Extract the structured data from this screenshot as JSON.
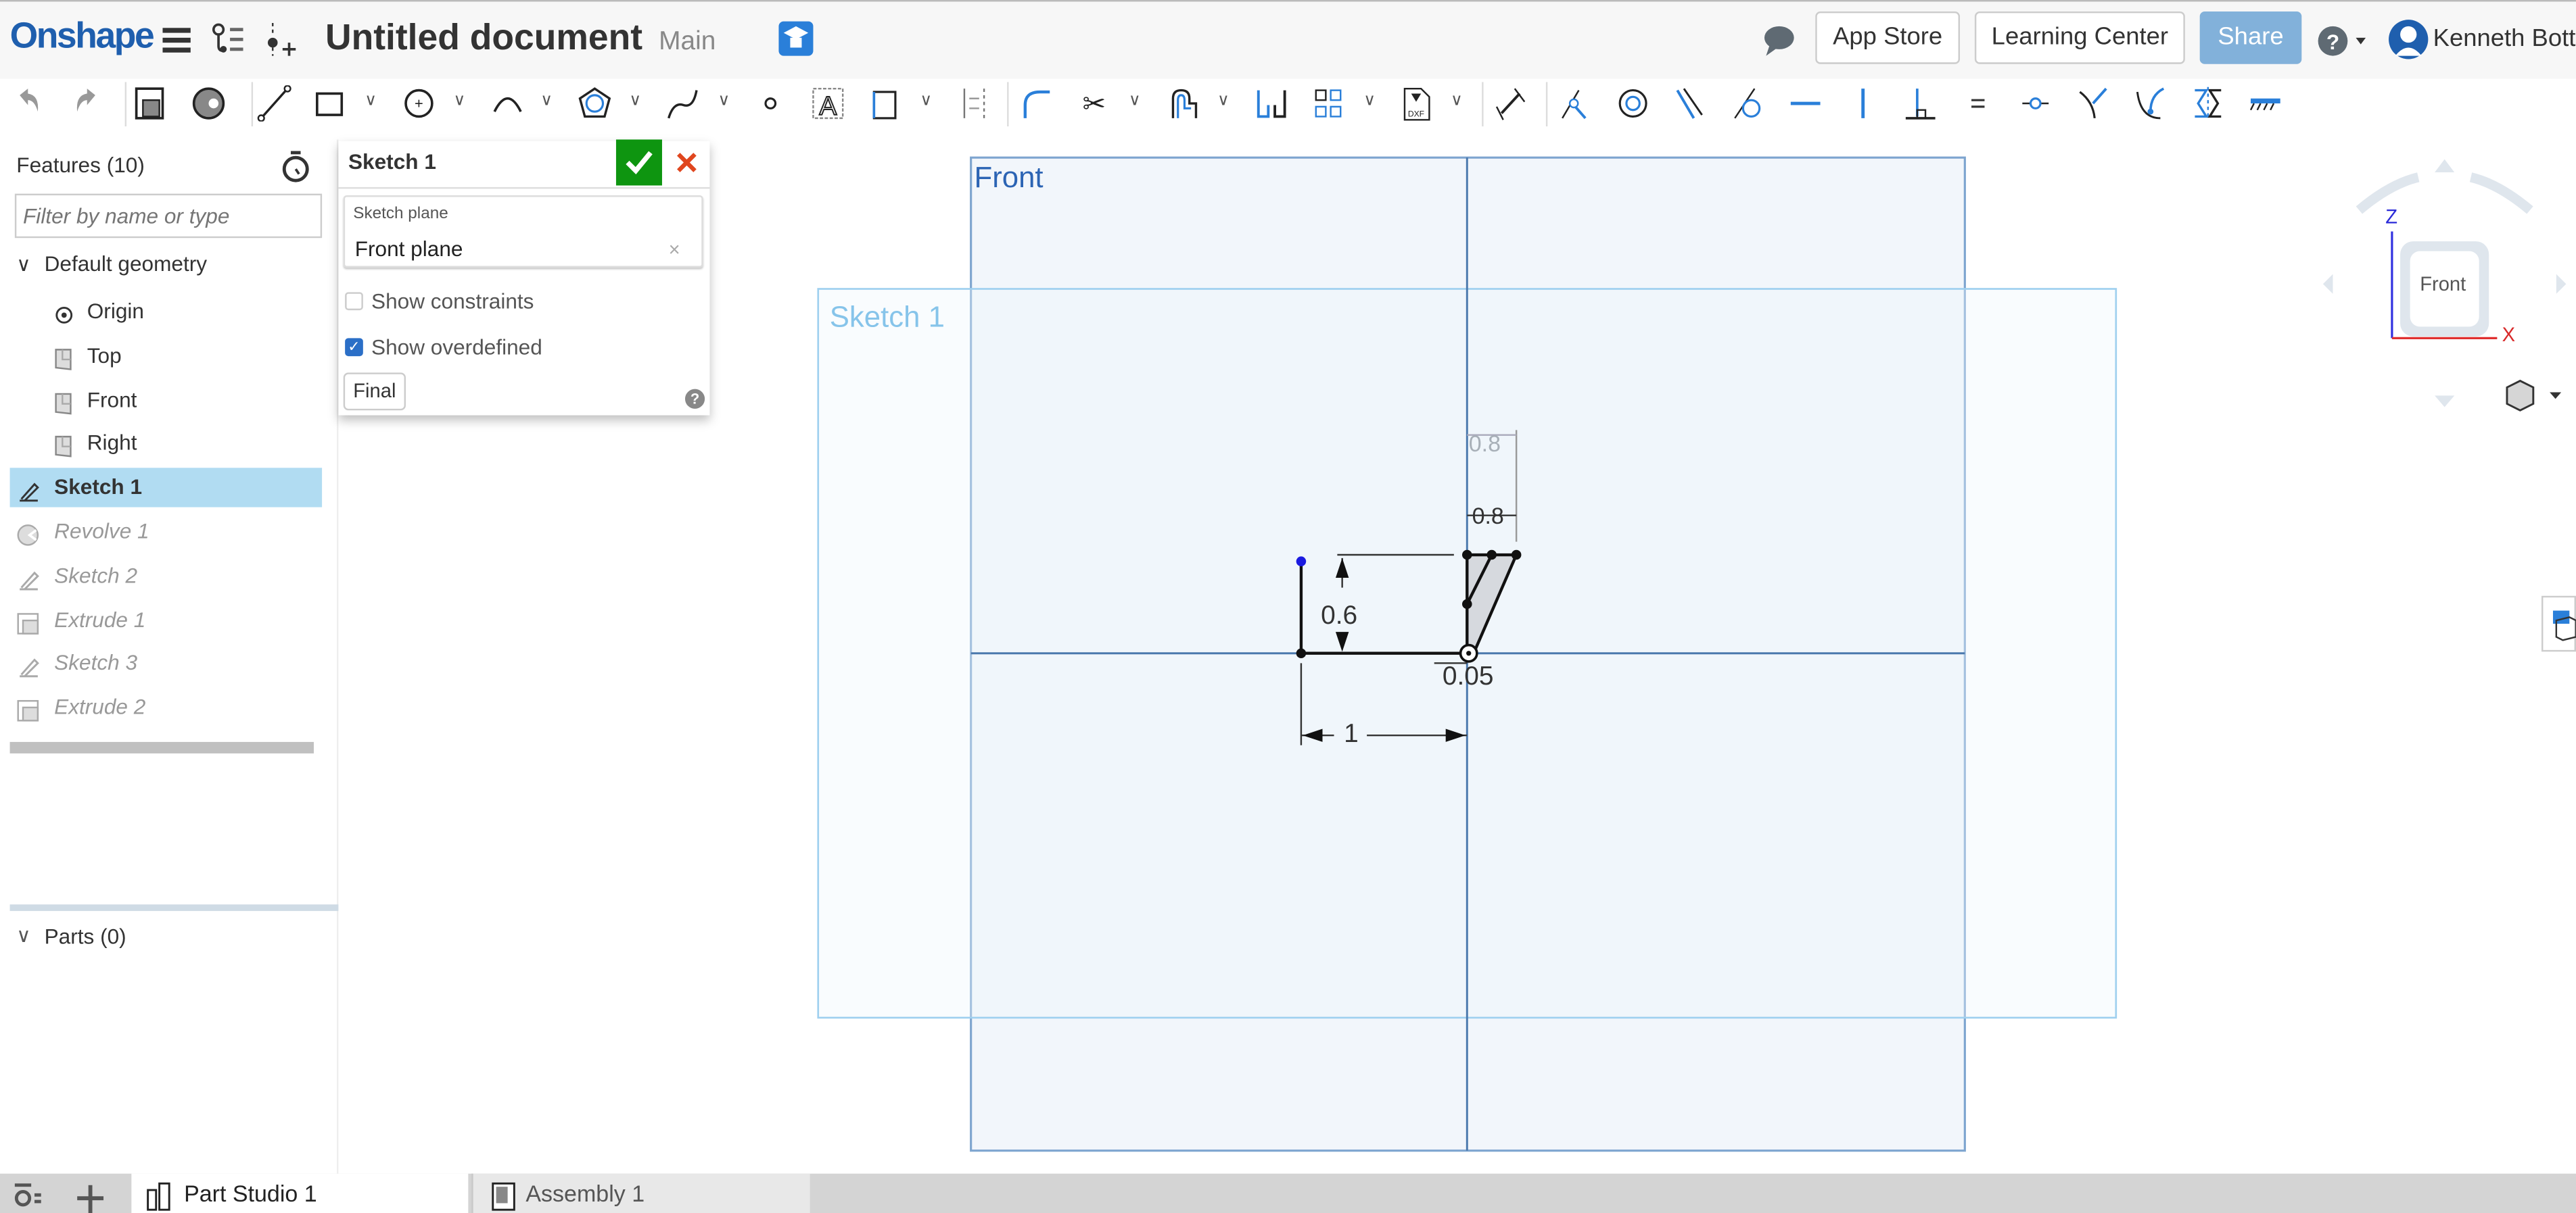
{
  "header": {
    "logo": "Onshape",
    "document_title": "Untitled document",
    "branch": "Main",
    "buttons": {
      "app_store": "App Store",
      "learning_center": "Learning Center",
      "share": "Share"
    },
    "user_name": "Kenneth Bott",
    "colors": {
      "brand": "#1f5fae",
      "share_bg": "#82b1da",
      "learn_badge": "#2a7fd9"
    }
  },
  "toolbar": {
    "tools": [
      {
        "icon": "undo-icon"
      },
      {
        "icon": "redo-icon"
      },
      {
        "icon": "extrude-icon"
      },
      {
        "icon": "revolve-icon"
      },
      {
        "icon": "line-icon"
      },
      {
        "icon": "rectangle-icon",
        "dropdown": true
      },
      {
        "icon": "circle-icon",
        "dropdown": true
      },
      {
        "icon": "arc-icon",
        "dropdown": true
      },
      {
        "icon": "polygon-icon",
        "dropdown": true
      },
      {
        "icon": "spline-icon",
        "dropdown": true
      },
      {
        "icon": "point-icon"
      },
      {
        "icon": "text-icon"
      },
      {
        "icon": "construction-icon",
        "dropdown": true
      },
      {
        "icon": "mirror-icon"
      },
      {
        "icon": "fillet-icon"
      },
      {
        "icon": "trim-icon",
        "dropdown": true
      },
      {
        "icon": "offset-icon",
        "dropdown": true
      },
      {
        "icon": "sketch-mirror-icon"
      },
      {
        "icon": "pattern-icon",
        "dropdown": true
      },
      {
        "icon": "dxf-import-icon",
        "dropdown": true
      },
      {
        "icon": "dimension-icon"
      },
      {
        "icon": "coincident-icon"
      },
      {
        "icon": "concentric-icon"
      },
      {
        "icon": "parallel-icon"
      },
      {
        "icon": "tangent-icon"
      },
      {
        "icon": "horizontal-icon"
      },
      {
        "icon": "vertical-icon"
      },
      {
        "icon": "perpendicular-icon"
      },
      {
        "icon": "equal-icon"
      },
      {
        "icon": "midpoint-icon"
      },
      {
        "icon": "normal-icon"
      },
      {
        "icon": "pierce-icon"
      },
      {
        "icon": "symmetric-icon"
      },
      {
        "icon": "fix-icon"
      }
    ]
  },
  "feature_panel": {
    "title": "Features (10)",
    "filter_placeholder": "Filter by name or type",
    "default_geometry_label": "Default geometry",
    "items": [
      {
        "label": "Origin",
        "icon": "origin-icon",
        "state": "normal",
        "indent": true
      },
      {
        "label": "Top",
        "icon": "plane-icon",
        "state": "normal",
        "indent": true
      },
      {
        "label": "Front",
        "icon": "plane-icon",
        "state": "normal",
        "indent": true
      },
      {
        "label": "Right",
        "icon": "plane-icon",
        "state": "normal",
        "indent": true
      },
      {
        "label": "Sketch 1",
        "icon": "sketch-icon",
        "state": "selected"
      },
      {
        "label": "Revolve 1",
        "icon": "revolve-icon",
        "state": "rolled-back"
      },
      {
        "label": "Sketch 2",
        "icon": "sketch-icon",
        "state": "rolled-back"
      },
      {
        "label": "Extrude 1",
        "icon": "extrude-icon",
        "state": "rolled-back"
      },
      {
        "label": "Sketch 3",
        "icon": "sketch-icon",
        "state": "rolled-back"
      },
      {
        "label": "Extrude 2",
        "icon": "extrude-icon",
        "state": "rolled-back"
      }
    ],
    "parts_label": "Parts (0)",
    "selected_color": "#b1dcf2"
  },
  "sketch_dialog": {
    "title": "Sketch 1",
    "sketch_plane_label": "Sketch plane",
    "sketch_plane_value": "Front plane",
    "clear_symbol": "×",
    "show_constraints_label": "Show constraints",
    "show_constraints_checked": false,
    "show_overdefined_label": "Show overdefined",
    "show_overdefined_checked": true,
    "final_button": "Final",
    "help_symbol": "?",
    "colors": {
      "ok": "#0e9510",
      "cancel": "#e0461e"
    }
  },
  "viewport": {
    "plane_labels": {
      "front": "Front",
      "sketch": "Sketch 1"
    },
    "dimensions": {
      "height": "0.6",
      "width": "1",
      "offset": "0.05",
      "top_dim_1": "0.8",
      "top_dim_2": "0.8"
    },
    "view_cube": {
      "face": "Front",
      "axis_z": "Z",
      "axis_x": "X"
    }
  },
  "tabs": [
    {
      "label": "Part Studio 1",
      "active": true
    },
    {
      "label": "Assembly 1",
      "active": false
    }
  ]
}
